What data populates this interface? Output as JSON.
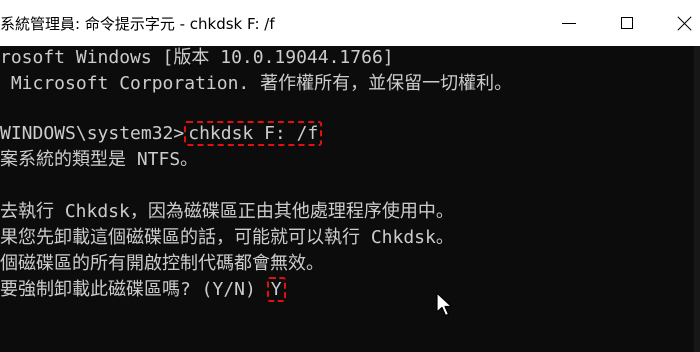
{
  "window": {
    "title": "系統管理員: 命令提示字元 - chkdsk  F: /f",
    "minimize_label": "minimize",
    "maximize_label": "maximize",
    "close_label": "close"
  },
  "console": {
    "lines": [
      "rosoft Windows [版本 10.0.19044.1766]",
      " Microsoft Corporation. 著作權所有，並保留一切權利。",
      "",
      "WINDOWS\\system32>",
      "案系統的類型是 NTFS。",
      "",
      "去執行 Chkdsk，因為磁碟區正由其他處理程序使用中。",
      "果您先卸載這個磁碟區的話，可能就可以執行 Chkdsk。",
      "個磁碟區的所有開啟控制代碼都會無效。",
      "要強制卸載此磁碟區嗎? (Y/N) "
    ],
    "command": "chkdsk F: /f",
    "answer": "Y"
  },
  "colors": {
    "console_bg": "#0c0c0c",
    "console_text": "#cccccc",
    "highlight": "#e01010"
  }
}
